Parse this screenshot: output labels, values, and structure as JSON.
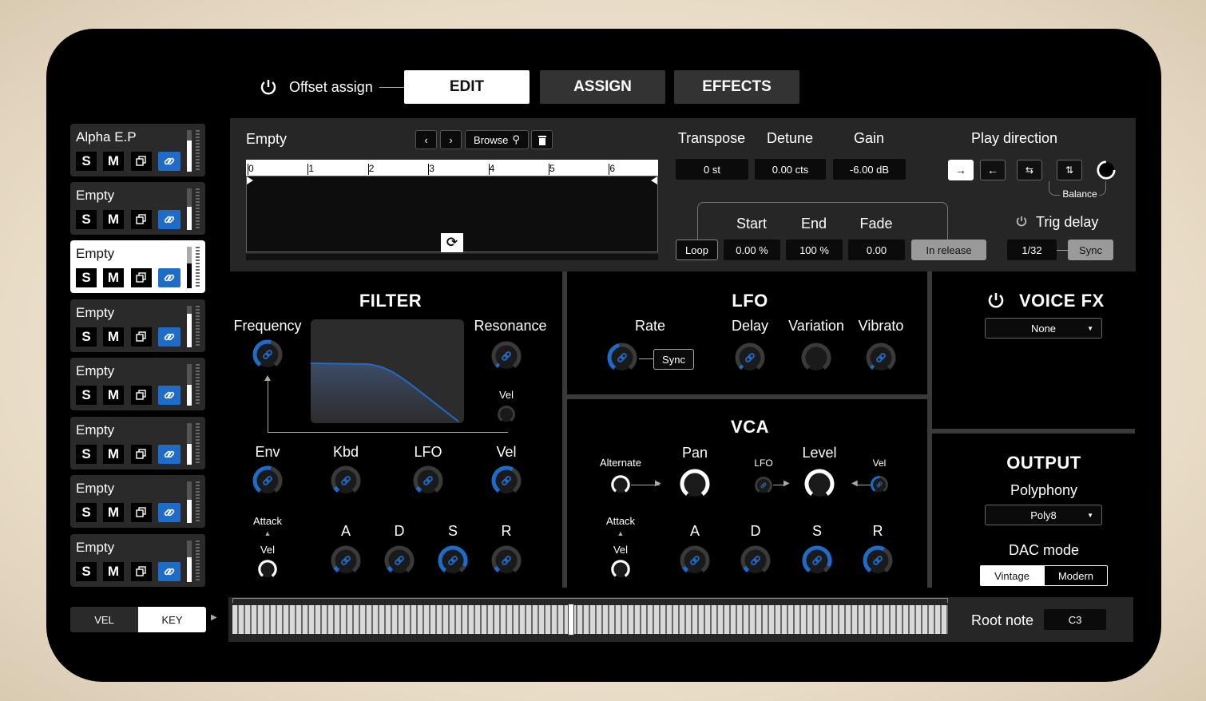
{
  "top": {
    "offset_assign": "Offset assign",
    "tabs": [
      "EDIT",
      "ASSIGN",
      "EFFECTS"
    ],
    "active_tab": "EDIT"
  },
  "layers": [
    {
      "name": "Alpha E.P",
      "active": false,
      "level": 0.75
    },
    {
      "name": "Empty",
      "active": false,
      "level": 0.55
    },
    {
      "name": "Empty",
      "active": true,
      "level": 0.6
    },
    {
      "name": "Empty",
      "active": false,
      "level": 0.8
    },
    {
      "name": "Empty",
      "active": false,
      "level": 0.5
    },
    {
      "name": "Empty",
      "active": false,
      "level": 0.5
    },
    {
      "name": "Empty",
      "active": false,
      "level": 0.55
    },
    {
      "name": "Empty",
      "active": false,
      "level": 0.6
    }
  ],
  "layer_buttons": {
    "solo": "S",
    "mute": "M"
  },
  "sample": {
    "name": "Empty",
    "browse": "Browse",
    "ruler": [
      "0",
      "1",
      "2",
      "3",
      "4",
      "5",
      "6"
    ]
  },
  "params": {
    "transpose": {
      "label": "Transpose",
      "value": "0 st"
    },
    "detune": {
      "label": "Detune",
      "value": "0.00 cts"
    },
    "gain": {
      "label": "Gain",
      "value": "-6.00 dB"
    },
    "play_direction": "Play direction",
    "balance": "Balance",
    "loop": "Loop",
    "start": {
      "label": "Start",
      "value": "0.00 %"
    },
    "end": {
      "label": "End",
      "value": "100 %"
    },
    "fade": {
      "label": "Fade",
      "value": "0.00"
    },
    "in_release": "In release",
    "trig_delay": {
      "label": "Trig delay",
      "value": "1/32",
      "sync": "Sync"
    }
  },
  "filter": {
    "title": "FILTER",
    "frequency": "Frequency",
    "resonance": "Resonance",
    "vel_small": "Vel",
    "mods": [
      "Env",
      "Kbd",
      "LFO",
      "Vel"
    ],
    "attack": "Attack",
    "vel": "Vel",
    "adsr": [
      "A",
      "D",
      "S",
      "R"
    ]
  },
  "lfo": {
    "title": "LFO",
    "rate": "Rate",
    "sync": "Sync",
    "delay": "Delay",
    "variation": "Variation",
    "vibrato": "Vibrato"
  },
  "vca": {
    "title": "VCA",
    "alternate": "Alternate",
    "pan": "Pan",
    "lfo": "LFO",
    "level": "Level",
    "vel": "Vel",
    "attack": "Attack",
    "vel2": "Vel",
    "adsr": [
      "A",
      "D",
      "S",
      "R"
    ]
  },
  "voice_fx": {
    "title": "VOICE FX",
    "value": "None"
  },
  "output": {
    "title": "OUTPUT",
    "polyphony": "Polyphony",
    "polyphony_value": "Poly8",
    "dac_mode": "DAC mode",
    "dac_options": [
      "Vintage",
      "Modern"
    ],
    "dac_selected": "Vintage"
  },
  "bottom": {
    "vel": "VEL",
    "key": "KEY",
    "key_selected": "KEY",
    "root_note_label": "Root note",
    "root_note_value": "C3"
  },
  "colors": {
    "accent": "#1e6cc8",
    "panel": "#262626",
    "background": "#000000",
    "bezel": "#e9dcc7"
  }
}
